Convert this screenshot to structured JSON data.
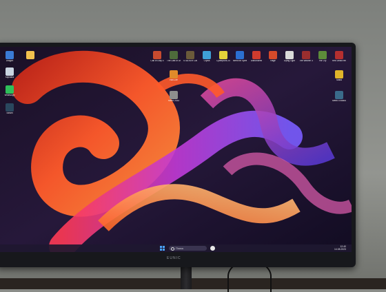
{
  "monitor": {
    "brand": "EUNIC"
  },
  "taskbar": {
    "search_placeholder": "Поиск",
    "time": "12:40",
    "date": "14.08.2023"
  },
  "desktop_icons": [
    {
      "label": "Dragon",
      "icon": "app-icon",
      "color": "#3a7bd5"
    },
    {
      "label": "Корзина",
      "icon": "recycle-bin-icon",
      "color": "#c9d4e0"
    },
    {
      "label": "",
      "icon": "folder-icon",
      "color": "#f2c14e"
    },
    {
      "label": "WhatsApp",
      "icon": "app-icon",
      "color": "#2fbf5a"
    },
    {
      "label": "Steam",
      "icon": "steam-icon",
      "color": "#2a475e"
    },
    {
      "label": "Call of Duty 4",
      "icon": "game-icon",
      "color": "#c94b2f"
    },
    {
      "label": "The Last of Us Part I",
      "icon": "game-icon",
      "color": "#4e6b3b"
    },
    {
      "label": "STALKER Call of Pripyat",
      "icon": "game-icon",
      "color": "#6b5a3a"
    },
    {
      "label": "Crysis",
      "icon": "game-icon",
      "color": "#3fa0d6"
    },
    {
      "label": "Cyberpunk 2077",
      "icon": "game-icon",
      "color": "#e3d23a"
    },
    {
      "label": "Need for Speed",
      "icon": "game-icon",
      "color": "#2b6fd1"
    },
    {
      "label": "Dishonored",
      "icon": "game-icon",
      "color": "#cf3b2e"
    },
    {
      "label": "Rage",
      "icon": "game-icon",
      "color": "#d64a2a"
    },
    {
      "label": "Dying Light",
      "icon": "game-icon",
      "color": "#d9d9d9"
    },
    {
      "label": "The Witcher 3",
      "icon": "game-icon",
      "color": "#9a2e2e"
    },
    {
      "label": "Far Cry",
      "icon": "game-icon",
      "color": "#5d8c3a"
    },
    {
      "label": "Red Dead Redemption",
      "icon": "game-icon",
      "color": "#b52f2f"
    },
    {
      "label": "Half-Life",
      "icon": "game-icon",
      "color": "#e08a2a"
    },
    {
      "label": "Metro 2033",
      "icon": "game-icon",
      "color": "#8e8e8e"
    },
    {
      "label": "Mafia",
      "icon": "game-icon",
      "color": "#e0b52a"
    },
    {
      "label": "Metro Exodus",
      "icon": "game-icon",
      "color": "#3a6b8a"
    }
  ]
}
